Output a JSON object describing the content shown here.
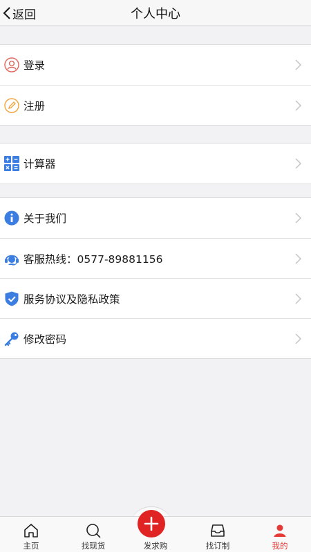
{
  "navbar": {
    "back_label": "返回",
    "title": "个人中心"
  },
  "groups": [
    {
      "items": [
        {
          "label": "登录",
          "icon": "user-circle-icon"
        },
        {
          "label": "注册",
          "icon": "pencil-circle-icon"
        }
      ]
    },
    {
      "items": [
        {
          "label": "计算器",
          "icon": "calculator-icon"
        }
      ]
    },
    {
      "items": [
        {
          "label": "关于我们",
          "icon": "info-icon"
        },
        {
          "label": "客服热线：0577-89881156",
          "icon": "headset-icon"
        },
        {
          "label": "服务协议及隐私政策",
          "icon": "shield-check-icon"
        },
        {
          "label": "修改密码",
          "icon": "key-icon"
        }
      ]
    }
  ],
  "tabbar": {
    "tabs": [
      {
        "label": "主页",
        "icon": "home-icon",
        "active": false
      },
      {
        "label": "找现货",
        "icon": "search-icon",
        "active": false
      },
      {
        "label": "发求购",
        "icon": "plus-icon",
        "active": false
      },
      {
        "label": "找订制",
        "icon": "inbox-icon",
        "active": false
      },
      {
        "label": "我的",
        "icon": "person-icon",
        "active": true
      }
    ]
  },
  "colors": {
    "accent": "#e53935",
    "icon_blue": "#3b7de0",
    "login_icon": "#e0645a",
    "register_icon": "#f2a23a"
  }
}
